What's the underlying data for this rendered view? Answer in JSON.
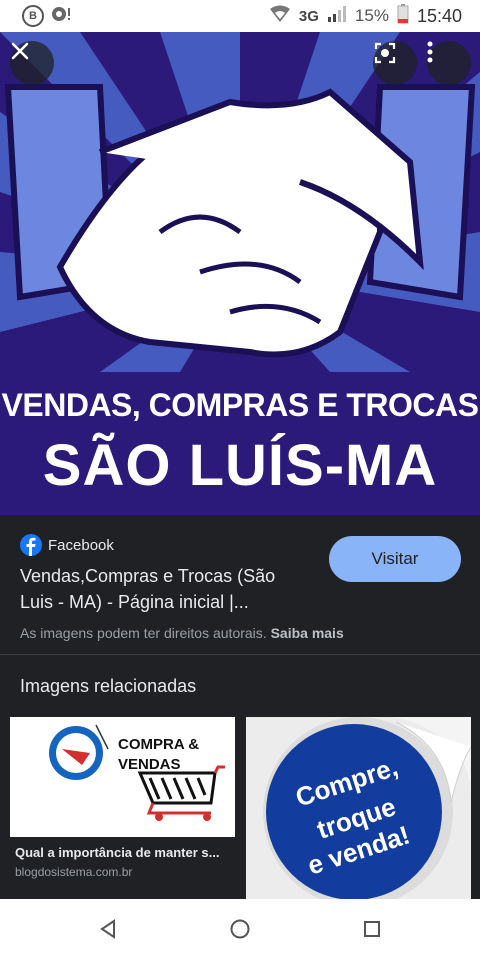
{
  "status_bar": {
    "network": "3G",
    "battery": "15%",
    "time": "15:40"
  },
  "hero": {
    "line1": "VENDAS, COMPRAS E TROCAS",
    "line2": "SÃO LUÍS-MA"
  },
  "result": {
    "source": "Facebook",
    "title": "Vendas,Compras e Trocas (São Luis - MA) - Página inicial |...",
    "visit_label": "Visitar",
    "rights_text": "As imagens podem ter direitos autorais.",
    "learn_more": "Saiba mais"
  },
  "related": {
    "heading": "Imagens relacionadas",
    "items": [
      {
        "image_text": "COMPRA & VENDAS",
        "caption": "Qual a importância de manter s...",
        "domain": "blogdosistema.com.br"
      },
      {
        "image_text_lines": [
          "Compre,",
          "troque",
          "e venda!"
        ]
      }
    ]
  },
  "colors": {
    "accent": "#8ab4f8",
    "background": "#202124",
    "hero_purple": "#2b1a7a",
    "facebook_blue": "#1877f2"
  },
  "icons": [
    "close-icon",
    "lens-icon",
    "more-vert-icon",
    "back-icon",
    "home-icon",
    "recents-icon"
  ]
}
